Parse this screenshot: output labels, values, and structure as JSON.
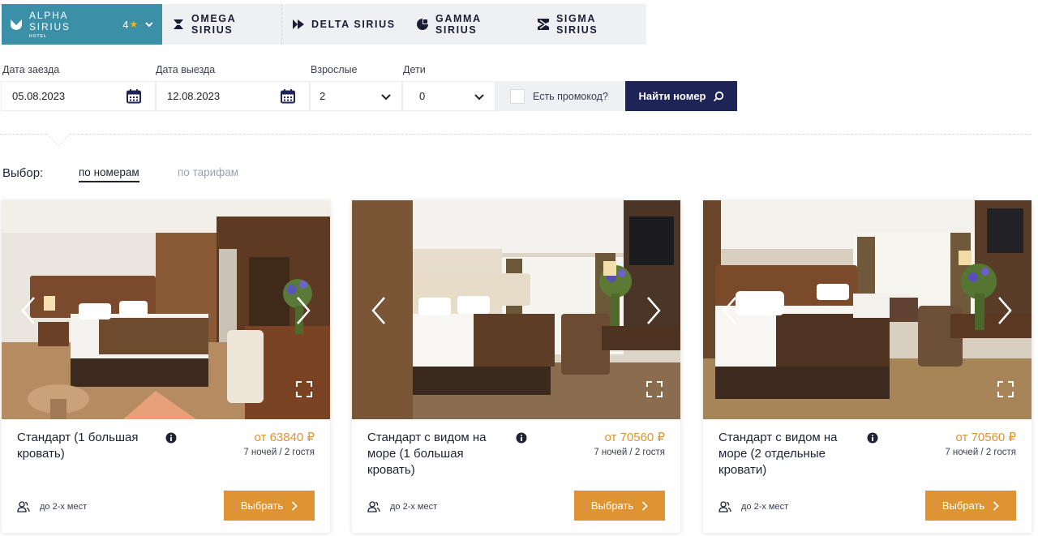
{
  "hotels": {
    "active": {
      "name": "ALPHA SIRIUS",
      "sub": "HOTEL",
      "stars": "4"
    },
    "others": [
      "OMEGA SIRIUS",
      "DELTA SIRIUS",
      "GAMMA SIRIUS",
      "SIGMA SIRIUS"
    ]
  },
  "search": {
    "checkin_label": "Дата заезда",
    "checkin_value": "05.08.2023",
    "checkout_label": "Дата выезда",
    "checkout_value": "12.08.2023",
    "adults_label": "Взрослые",
    "adults_value": "2",
    "children_label": "Дети",
    "children_value": "0",
    "promo_label": "Есть промокод?",
    "find_button": "Найти номер"
  },
  "selection": {
    "label": "Выбор:",
    "tab_rooms": "по номерам",
    "tab_rates": "по тарифам"
  },
  "rooms": [
    {
      "title": "Стандарт (1 большая кровать)",
      "price": "от 63840 ₽",
      "nights": "7 ночей / 2 гостя",
      "capacity": "до 2-х мест",
      "button": "Выбрать"
    },
    {
      "title": "Стандарт с видом на море (1 большая кровать)",
      "price": "от 70560 ₽",
      "nights": "7 ночей / 2 гостя",
      "capacity": "до 2-х мест",
      "button": "Выбрать"
    },
    {
      "title": "Стандарт с видом на море (2 отдельные кровати)",
      "price": "от 70560 ₽",
      "nights": "7 ночей / 2 гостя",
      "capacity": "до 2-х мест",
      "button": "Выбрать"
    }
  ],
  "colors": {
    "active_tab": "#3b8fa6",
    "tabs_bg": "#eef0f4",
    "primary_button": "#1f2456",
    "price": "#e0932e",
    "select_button": "#df9434",
    "star": "#f5b414"
  },
  "icons": [
    "alpha-logo-icon",
    "omega-logo-icon",
    "delta-logo-icon",
    "gamma-logo-icon",
    "sigma-logo-icon",
    "calendar-icon",
    "chevron-down-icon",
    "search-icon",
    "info-icon",
    "guests-icon",
    "chevron-right-icon",
    "fullscreen-icon",
    "arrow-left-icon",
    "arrow-right-icon"
  ]
}
